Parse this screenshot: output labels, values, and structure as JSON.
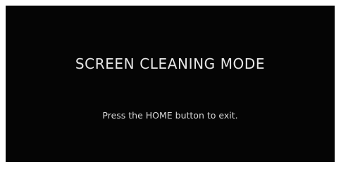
{
  "screen": {
    "title": "SCREEN CLEANING MODE",
    "instruction": "Press the HOME button to exit."
  },
  "colors": {
    "background": "#050505",
    "text": "#e6e6e6",
    "frame": "#ffffff"
  }
}
